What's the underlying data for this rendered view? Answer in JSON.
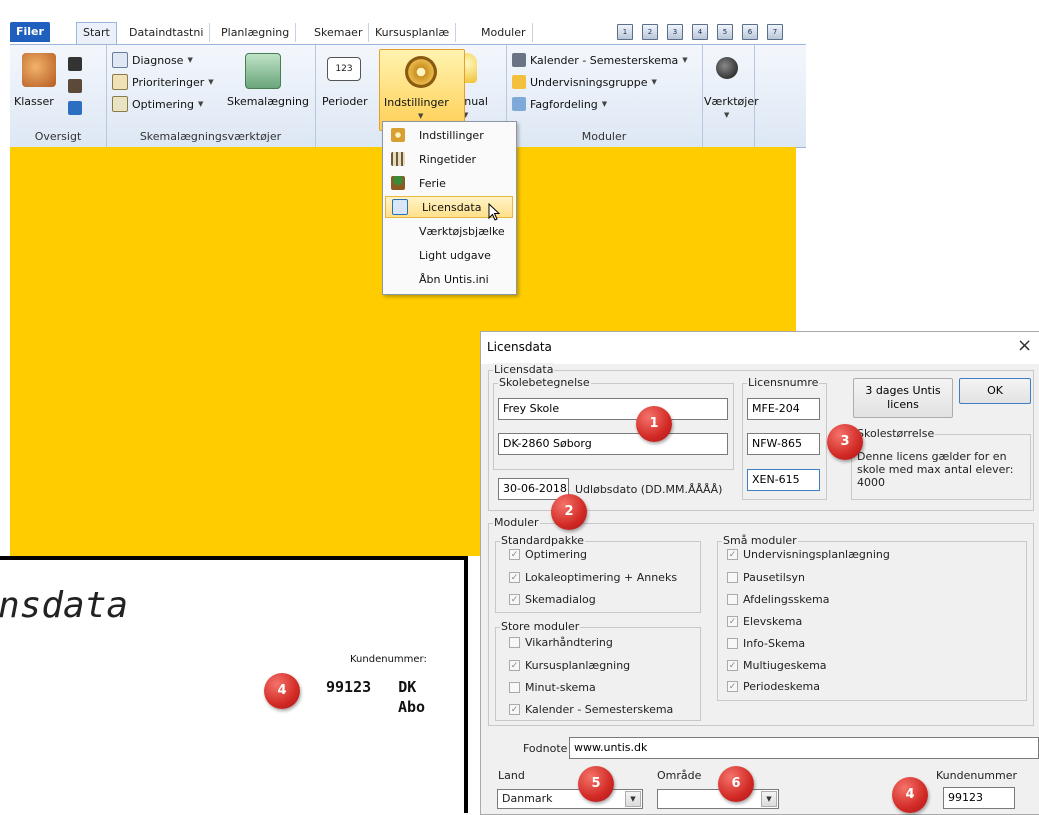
{
  "app": {
    "tabs": [
      "Filer",
      "Start",
      "Dataindtastni",
      "Planlægning",
      "Skemaer",
      "Kursusplanlæ",
      "Moduler"
    ],
    "quick_access_count": 7
  },
  "ribbon": {
    "oversigt": {
      "big_label": "Klasser",
      "group_label": "Oversigt"
    },
    "skemalaegning": {
      "items": [
        "Diagnose",
        "Prioriteringer",
        "Optimering"
      ],
      "big_label": "Skemalægning",
      "group_label": "Skemalægningsværktøjer"
    },
    "perioder_label": "Perioder",
    "indstillinger_label": "Indstillinger",
    "manual_label": "Manual",
    "moduler": {
      "items": [
        "Kalender - Semesterskema",
        "Undervisningsgruppe",
        "Fagfordeling"
      ],
      "group_label": "Moduler"
    },
    "vaerktojer_label": "Værktøjer"
  },
  "dropdown": {
    "items": [
      "Indstillinger",
      "Ringetider",
      "Ferie",
      "Licensdata",
      "Værktøjsbjælke",
      "Light udgave",
      "Åbn Untis.ini"
    ],
    "highlighted": "Licensdata"
  },
  "dialog": {
    "title": "Licensdata",
    "close_glyph": "×",
    "licensdata_legend": "Licensdata",
    "skolebetegnelse_legend": "Skolebetegnelse",
    "school_name": "Frey Skole",
    "school_address": "DK-2860 Søborg",
    "expiry_date": "30-06-2018",
    "expiry_label": "Udløbsdato (DD.MM.ÅÅÅÅ)",
    "licensnumre_legend": "Licensnumre",
    "license_numbers": [
      "MFE-204",
      "NFW-865",
      "XEN-615"
    ],
    "trial_button": "3 dages Untis licens",
    "ok_button": "OK",
    "skolestorrelse_legend": "Skolestørrelse",
    "skolestorrelse_text": "Denne licens gælder for en skole med max antal elever: 4000",
    "moduler_legend": "Moduler",
    "standardpakke": {
      "legend": "Standardpakke",
      "items": [
        {
          "label": "Optimering",
          "checked": true
        },
        {
          "label": "Lokaleoptimering + Anneks",
          "checked": true
        },
        {
          "label": "Skemadialog",
          "checked": true
        }
      ]
    },
    "store_moduler": {
      "legend": "Store moduler",
      "items": [
        {
          "label": "Vikarhåndtering",
          "checked": false
        },
        {
          "label": "Kursusplanlægning",
          "checked": true
        },
        {
          "label": "Minut-skema",
          "checked": false
        },
        {
          "label": "Kalender - Semesterskema",
          "checked": true
        }
      ]
    },
    "smaa_moduler": {
      "legend": "Små moduler",
      "items": [
        {
          "label": "Undervisningsplanlægning",
          "checked": true
        },
        {
          "label": "Pausetilsyn",
          "checked": false
        },
        {
          "label": "Afdelingsskema",
          "checked": false
        },
        {
          "label": "Elevskema",
          "checked": true
        },
        {
          "label": "Info-Skema",
          "checked": false
        },
        {
          "label": "Multiugeskema",
          "checked": true
        },
        {
          "label": "Periodeskema",
          "checked": true
        }
      ]
    },
    "fodnote_label": "Fodnote",
    "fodnote_value": "www.untis.dk",
    "land_label": "Land",
    "land_value": "Danmark",
    "omraade_label": "Område",
    "omraade_value": "",
    "kundenummer_label": "Kundenummer",
    "kundenummer_value": "99123"
  },
  "certificate": {
    "heading_fragment": "nsdata",
    "kundenummer_label": "Kundenummer:",
    "kundenummer_value": "99123   DK",
    "subscription": "Abo"
  },
  "callouts": [
    "1",
    "2",
    "3",
    "4",
    "5",
    "6",
    "4"
  ],
  "colors": {
    "workspace_yellow": "#ffcc00",
    "filer_tab": "#1f5fbd",
    "callout_red": "#d22a25",
    "highlight": "#ffe08a"
  }
}
